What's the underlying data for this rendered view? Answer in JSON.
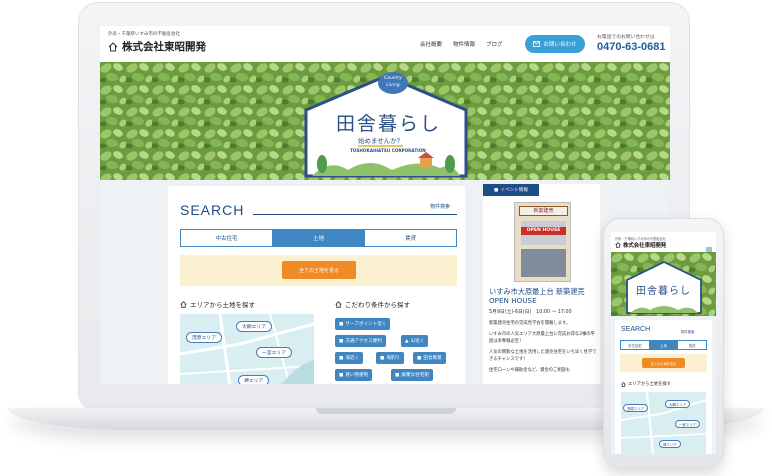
{
  "header": {
    "tagline": "外房・千葉県いすみ市の不動産会社",
    "company": "株式会社東昭開発",
    "nav": [
      "会社概要",
      "物件情報",
      "ブログ"
    ],
    "contact_label": "お問い合わせ",
    "tel_label": "お電話でのお問い合わせは",
    "tel": "0470-63-0681"
  },
  "hero": {
    "badge": "Country Living",
    "title": "田舎暮らし",
    "subtitle": "始めませんか？",
    "english": "TOSHOKAIHATSU CORPORATION"
  },
  "search": {
    "title": "SEARCH",
    "link": "物件検索",
    "tabs": [
      "中古住宅",
      "土地",
      "賃貸"
    ],
    "active_tab": "土地",
    "all_button": "全ての土地を見る",
    "area_heading": "エリアから土地を探す",
    "conditions_heading": "こだわり条件から探す",
    "areas": [
      "大網エリア",
      "茂原エリア",
      "一宮エリア",
      "岬エリア"
    ],
    "conditions": [
      "サーフポイント近く",
      "交通アクセス便利",
      "山近く",
      "海近く",
      "海釣り",
      "田舎風景",
      "買い物便利",
      "廃棄な住宅街"
    ]
  },
  "event": {
    "tag": "イベント情報",
    "flyer_label": "新築建売",
    "flyer_banner": "OPEN HOUSE",
    "title": "いすみ市大原最上台 新築建売 OPEN HOUSE",
    "date": "5月9日(土)-6日(日)　10:00 ～ 17:00",
    "body": [
      "新築建売住宅の完成見学会を開催します。",
      "いすみ市の人気エリア大原最上台に完成お得な2棟の平屋は争奪戦必至！",
      "人気の閑散な土地を活用した建売住宅をいち早く見学できるチャンスです！",
      "住宅ローンや補助金など、資金のご相談も"
    ]
  },
  "phone": {
    "tagline": "外房・千葉県いすみ市の不動産会社",
    "company": "株式会社東昭開発",
    "menu": "MENU",
    "title": "田舎暮らし",
    "search_title": "SEARCH",
    "search_link": "物件検索",
    "tabs": [
      "中古住宅",
      "土地",
      "賃貸"
    ],
    "all_button": "全ての土地を見る",
    "area_heading": "エリアから土地を探す",
    "areas": [
      "茂原エリア",
      "大網エリア",
      "一宮エリア",
      "岬エリア"
    ]
  },
  "colors": {
    "brand_blue": "#1e4c86",
    "accent_blue": "#3f86c2",
    "contact_button": "#3aa0d8",
    "orange": "#f08a24",
    "cream": "#fbf1d0",
    "map_bg": "#d9eef0"
  }
}
